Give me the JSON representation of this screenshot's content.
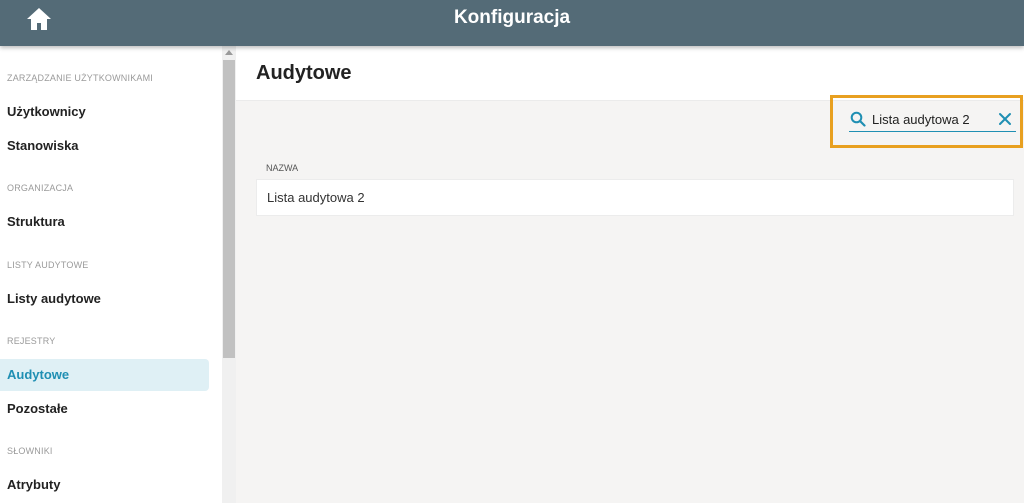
{
  "header": {
    "title": "Konfiguracja",
    "home_icon": "home-icon"
  },
  "sidebar": {
    "sections": [
      {
        "label": "ZARZĄDZANIE UŻYTKOWNIKAMI",
        "items": [
          "Użytkownicy",
          "Stanowiska"
        ]
      },
      {
        "label": "ORGANIZACJA",
        "items": [
          "Struktura"
        ]
      },
      {
        "label": "LISTY AUDYTOWE",
        "items": [
          "Listy audytowe"
        ]
      },
      {
        "label": "REJESTRY",
        "items": [
          "Audytowe",
          "Pozostałe"
        ]
      },
      {
        "label": "SŁOWNIKI",
        "items": [
          "Atrybuty"
        ]
      }
    ],
    "active_item": "Audytowe"
  },
  "main": {
    "title": "Audytowe",
    "search": {
      "value": "Lista audytowa 2",
      "icon": "search-icon",
      "clear_icon": "close-icon"
    },
    "table": {
      "columns": [
        "NAZWA"
      ],
      "rows": [
        [
          "Lista audytowa 2"
        ]
      ]
    }
  },
  "colors": {
    "topbar": "#546b77",
    "accent": "#1f8fb3",
    "active_bg": "#dff0f5",
    "highlight": "#e8a020"
  }
}
